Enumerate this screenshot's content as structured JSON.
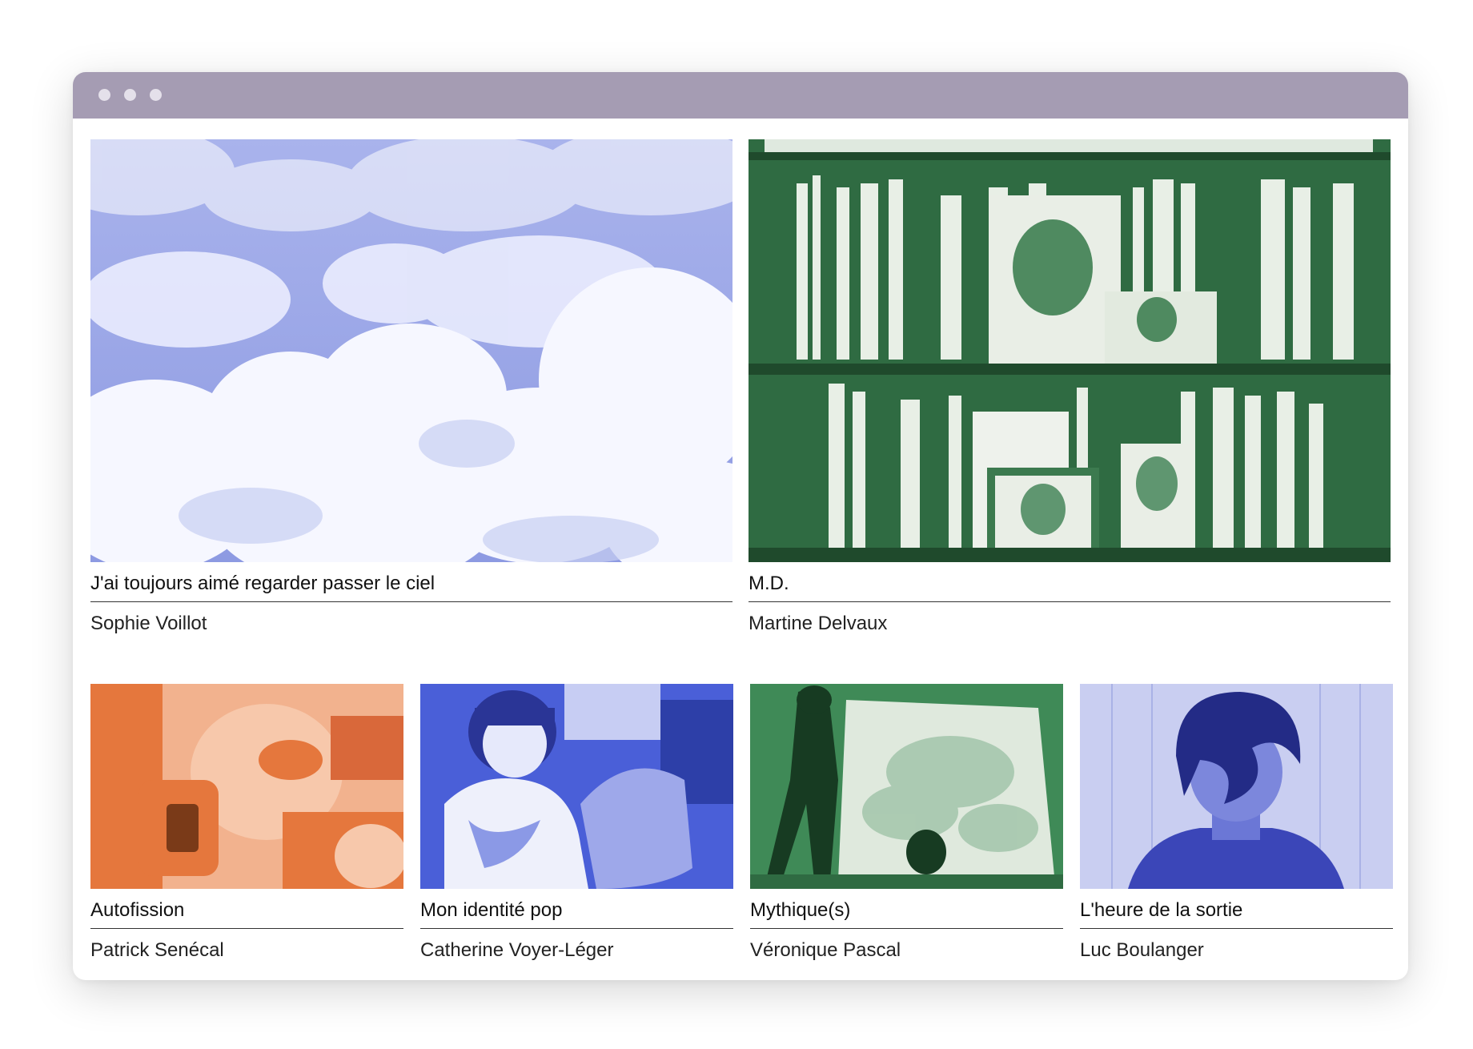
{
  "window": {
    "titlebar_color": "#a59cb3",
    "controls": [
      "window-dot",
      "window-dot",
      "window-dot"
    ]
  },
  "featured": [
    {
      "title": "J'ai toujours aimé regarder passer le ciel",
      "author": "Sophie Voillot",
      "image": "clouds",
      "tint": "#8f9be0"
    },
    {
      "title": "M.D.",
      "author": "Martine Delvaux",
      "image": "bookshelf",
      "tint": "#3f8a57"
    }
  ],
  "items": [
    {
      "title": "Autofission",
      "author": "Patrick Senécal",
      "image": "man-with-camera",
      "tint": "#e5773d"
    },
    {
      "title": "Mon identité pop",
      "author": "Catherine Voyer-Léger",
      "image": "girl-smiling",
      "tint": "#4a5fd8"
    },
    {
      "title": "Mythique(s)",
      "author": "Véronique Pascal",
      "image": "stage-performance",
      "tint": "#3f8a57"
    },
    {
      "title": "L'heure de la sortie",
      "author": "Luc Boulanger",
      "image": "boy-portrait",
      "tint": "#5a67d4"
    }
  ]
}
